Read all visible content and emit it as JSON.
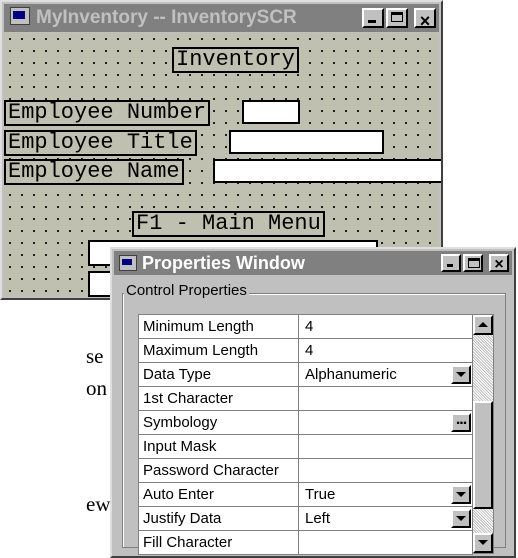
{
  "inventory_window": {
    "title": "MyInventory -- InventorySCR",
    "form": {
      "heading": "Inventory",
      "fields": [
        {
          "label": "Employee Number"
        },
        {
          "label": "Employee Title"
        },
        {
          "label": "Employee Name"
        }
      ],
      "menu_label": "F1 - Main Menu"
    }
  },
  "background_text": [
    "se",
    "on",
    "ew"
  ],
  "properties_window": {
    "title": "Properties Window",
    "group_label": "Control Properties",
    "rows": [
      {
        "name": "Minimum Length",
        "value": "4"
      },
      {
        "name": "Maximum Length",
        "value": "4"
      },
      {
        "name": "Data Type",
        "value": "Alphanumeric"
      },
      {
        "name": "1st Character",
        "value": ""
      },
      {
        "name": "Symbology",
        "value": ""
      },
      {
        "name": "Input Mask",
        "value": ""
      },
      {
        "name": "Password Character",
        "value": ""
      },
      {
        "name": "Auto Enter",
        "value": "True"
      },
      {
        "name": "Justify Data",
        "value": "Left"
      },
      {
        "name": "Fill Character",
        "value": ""
      }
    ]
  },
  "colors": {
    "title_bar_inactive": "#808080",
    "window_face": "#c0c0c0",
    "form_canvas": "#c0c0b0"
  }
}
